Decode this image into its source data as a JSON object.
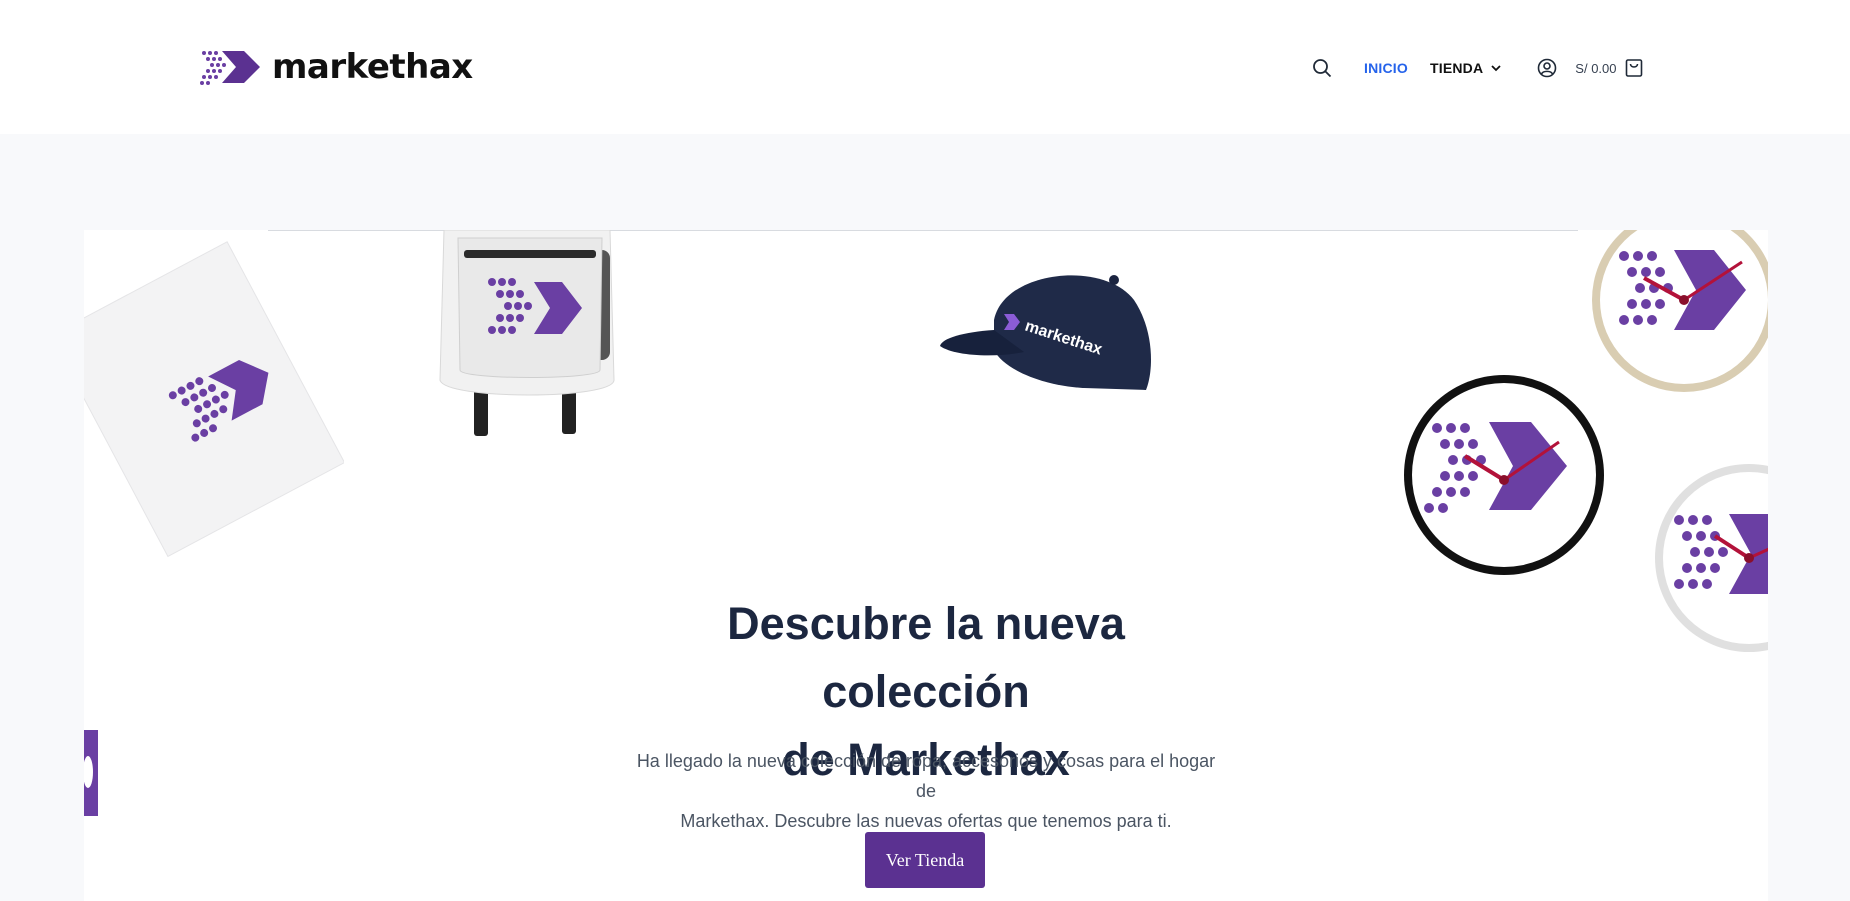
{
  "brand": {
    "name": "markethax",
    "colors": {
      "purple": "#5b3191",
      "purple_light": "#7a4bb3",
      "link_active": "#2563eb"
    }
  },
  "nav": {
    "search_icon": "search-icon",
    "links": [
      {
        "label": "INICIO",
        "active": true
      },
      {
        "label": "TIENDA",
        "active": false,
        "has_dropdown": true
      }
    ],
    "account_icon": "user-circle-icon",
    "cart": {
      "total": "S/ 0.00",
      "icon": "shopping-bag-icon"
    }
  },
  "hero": {
    "title_line1": "Descubre la nueva colección",
    "title_line2": "de Markethax",
    "description_line1": "Ha llegado la nueva colección de ropa, accesorios y cosas para el hogar de",
    "description_line2": "Markethax. Descubre las nuevas ofertas que tenemos para ti.",
    "cta_label": "Ver Tienda",
    "cap_text": "markethax",
    "products": [
      "notebook",
      "backpack",
      "cap",
      "clock",
      "clock",
      "clock",
      "mug"
    ]
  }
}
